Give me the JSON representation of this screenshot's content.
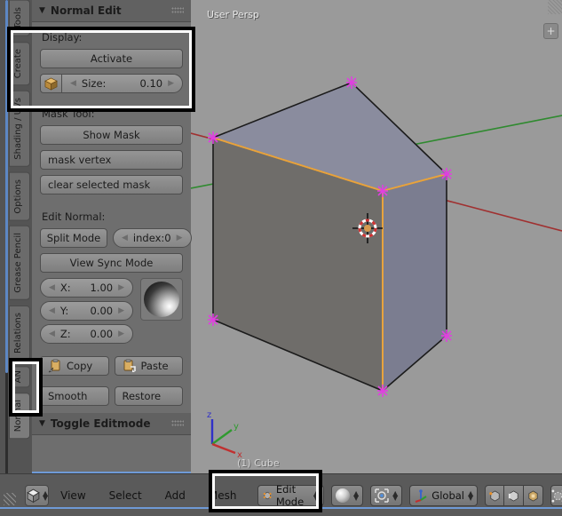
{
  "viewport": {
    "perspective_label": "User Persp",
    "object_name": "(1) Cube",
    "axis_gizmo": {
      "z": "z",
      "y": "y",
      "x": "x"
    },
    "add_button": "+",
    "colors": {
      "background": "#9a9a9a",
      "cube_top": "#8a8c9e",
      "cube_left": "#6f6d6a",
      "cube_right": "#7b7d90",
      "selected_edge": "#e8a33d",
      "normal_marker": "#e040e0",
      "axis_x": "#b03030",
      "axis_y": "#2f8a2f",
      "axis_z": "#3030b0"
    }
  },
  "shelf": {
    "tabs": [
      {
        "label": "Tools",
        "active": false
      },
      {
        "label": "Create",
        "active": false
      },
      {
        "label": "Shading / UVs",
        "active": false
      },
      {
        "label": "Options",
        "active": false
      },
      {
        "label": "Grease Pencil",
        "active": false
      },
      {
        "label": "Relations",
        "active": false
      },
      {
        "label": "AN",
        "active": false
      },
      {
        "label": "Normal",
        "active": true
      }
    ],
    "panels": [
      {
        "title": "Normal Edit",
        "display_label": "Display:",
        "activate_button": "Activate",
        "size_key": "Size:",
        "size_value": "0.10",
        "mask_label": "Mask Tool:",
        "show_mask": "Show Mask",
        "mask_vertex": "mask vertex",
        "clear_selected_mask": "clear selected mask",
        "edit_normal_label": "Edit Normal:",
        "split_mode": "Split Mode",
        "index_key": "index:",
        "index_value": "0",
        "view_sync_mode": "View Sync Mode",
        "x_key": "X:",
        "x_value": "1.00",
        "y_key": "Y:",
        "y_value": "0.00",
        "z_key": "Z:",
        "z_value": "0.00",
        "copy": "Copy",
        "paste": "Paste",
        "smooth": "Smooth",
        "restore": "Restore"
      },
      {
        "title": "Toggle Editmode"
      }
    ]
  },
  "bottom_bar": {
    "menus": [
      "View",
      "Select",
      "Add",
      "Mesh"
    ],
    "mode_selector": "Edit Mode",
    "transform_orientation": "Global"
  }
}
